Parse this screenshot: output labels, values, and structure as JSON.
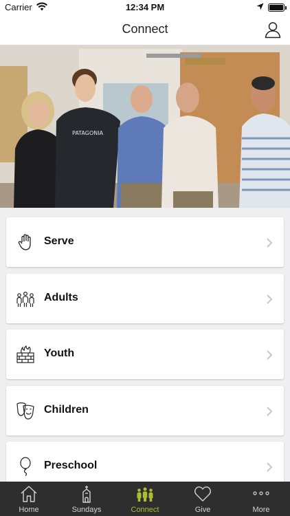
{
  "status_bar": {
    "carrier": "Carrier",
    "time": "12:34 PM"
  },
  "header": {
    "title": "Connect"
  },
  "hero": {
    "description_icon": "group-photo"
  },
  "menu": [
    {
      "label": "Serve",
      "icon": "raised-hand-icon"
    },
    {
      "label": "Adults",
      "icon": "people-icon"
    },
    {
      "label": "Youth",
      "icon": "fire-wall-icon"
    },
    {
      "label": "Children",
      "icon": "smiley-mask-icon"
    },
    {
      "label": "Preschool",
      "icon": "balloon-icon"
    }
  ],
  "tabs": [
    {
      "label": "Home",
      "icon": "home-icon"
    },
    {
      "label": "Sundays",
      "icon": "church-icon"
    },
    {
      "label": "Connect",
      "icon": "people-icon",
      "active": true
    },
    {
      "label": "Give",
      "icon": "heart-icon"
    },
    {
      "label": "More",
      "icon": "more-dots-icon"
    }
  ],
  "colors": {
    "accent": "#a9bd36",
    "tabbar_bg": "#2e2e2e"
  }
}
